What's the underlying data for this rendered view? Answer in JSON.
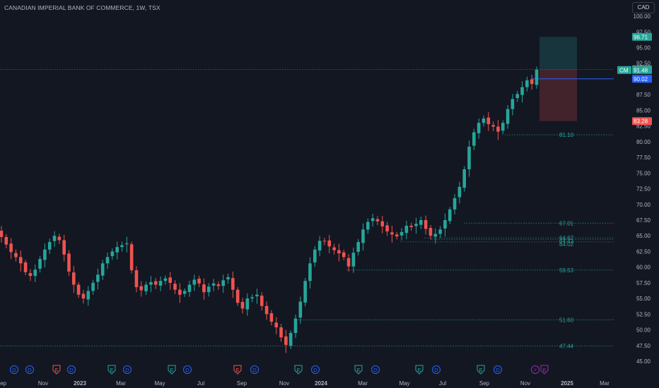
{
  "header": {
    "title": "CANADIAN IMPERIAL BANK OF COMMERCE, 1W, TSX",
    "currency": "CAD"
  },
  "colors": {
    "background": "#131722",
    "up": "#26a69a",
    "down": "#ef5350",
    "axis_text": "#b2b5be",
    "blue_line": "#2962ff",
    "event_dividend": "#2962ff",
    "event_earnings_up": "#26a69a",
    "event_earnings_down": "#ef5350",
    "event_split": "#9c27b0"
  },
  "chart_data": {
    "type": "candlestick",
    "title": "CANADIAN IMPERIAL BANK OF COMMERCE, 1W, TSX",
    "ylim": [
      44,
      102
    ],
    "y_ticks": [
      "45.00",
      "47.50",
      "50.00",
      "52.50",
      "55.00",
      "57.50",
      "60.00",
      "62.50",
      "65.00",
      "67.50",
      "70.00",
      "72.50",
      "75.00",
      "77.50",
      "80.00",
      "82.50",
      "85.00",
      "87.50",
      "90.00",
      "92.50",
      "95.00",
      "97.50",
      "100.00"
    ],
    "x_ticks": [
      "Sep",
      "Nov",
      "2023",
      "Mar",
      "May",
      "Jul",
      "Sep",
      "Nov",
      "2024",
      "Mar",
      "May",
      "Jul",
      "Sep",
      "Nov",
      "2025",
      "Mar"
    ],
    "closes": [
      64.8,
      63.6,
      62.4,
      61.6,
      60.6,
      59.2,
      58.6,
      59.6,
      61.3,
      62.8,
      64.0,
      65.0,
      64.3,
      62.0,
      59.3,
      57.2,
      55.6,
      55.0,
      56.2,
      57.5,
      58.8,
      60.6,
      61.6,
      62.5,
      63.2,
      63.5,
      63.8,
      59.5,
      56.8,
      56.3,
      57.2,
      57.6,
      57.2,
      57.8,
      58.2,
      57.5,
      56.4,
      55.6,
      56.2,
      57.2,
      58.0,
      57.4,
      56.0,
      56.9,
      57.4,
      57.0,
      57.9,
      58.4,
      56.4,
      54.3,
      53.4,
      55.0,
      55.2,
      55.6,
      53.8,
      52.5,
      51.3,
      50.4,
      48.8,
      47.6,
      49.5,
      51.8,
      54.5,
      57.8,
      60.6,
      62.8,
      64.2,
      64.1,
      63.3,
      62.7,
      62.2,
      61.6,
      60.1,
      62.3,
      64.0,
      66.0,
      67.2,
      67.8,
      67.3,
      66.5,
      65.7,
      65.2,
      64.9,
      65.6,
      66.6,
      66.4,
      66.9,
      67.5,
      66.1,
      65.0,
      65.3,
      66.0,
      67.5,
      69.2,
      71.0,
      72.8,
      75.6,
      79.2,
      81.5,
      83.0,
      83.7,
      82.8,
      82.4,
      81.6,
      83.0,
      85.2,
      86.8,
      87.6,
      88.7,
      89.8,
      89.2,
      91.48
    ],
    "series": [
      {
        "name": "CM",
        "last": 91.48
      }
    ],
    "levels": [
      "97.50",
      "81.10",
      "67.01",
      "64.67",
      "64.43",
      "64.02",
      "59.53",
      "51.60",
      "47.44"
    ],
    "price_labels": {
      "target": "96.71",
      "entry": "91.50",
      "cm": "91.48",
      "blue": "90.02",
      "stop": "83.28"
    },
    "position": {
      "target": 96.71,
      "entry": 91.5,
      "stop": 83.28
    },
    "events": [
      {
        "letter": "D",
        "kind": "dividend"
      },
      {
        "letter": "D",
        "kind": "dividend"
      },
      {
        "letter": "E",
        "kind": "earnings-down"
      },
      {
        "letter": "D",
        "kind": "dividend"
      },
      {
        "letter": "E",
        "kind": "earnings-up"
      },
      {
        "letter": "D",
        "kind": "dividend"
      },
      {
        "letter": "E",
        "kind": "earnings-up"
      },
      {
        "letter": "D",
        "kind": "dividend"
      },
      {
        "letter": "E",
        "kind": "earnings-down"
      },
      {
        "letter": "D",
        "kind": "dividend"
      },
      {
        "letter": "E",
        "kind": "earnings-up"
      },
      {
        "letter": "D",
        "kind": "dividend"
      },
      {
        "letter": "E",
        "kind": "earnings-up"
      },
      {
        "letter": "D",
        "kind": "dividend"
      },
      {
        "letter": "E",
        "kind": "earnings-up"
      },
      {
        "letter": "D",
        "kind": "dividend"
      },
      {
        "letter": "E",
        "kind": "earnings-up"
      },
      {
        "letter": "D",
        "kind": "dividend"
      },
      {
        "letter": "⚡",
        "kind": "split"
      },
      {
        "letter": "E",
        "kind": "split"
      }
    ]
  }
}
